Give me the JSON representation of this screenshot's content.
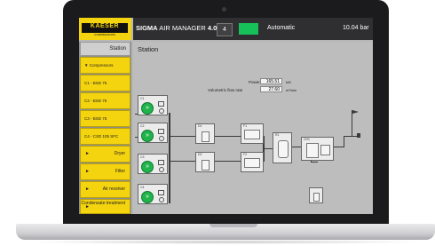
{
  "header": {
    "logo_text": "KAESER",
    "logo_sub": "COMPRESSORS",
    "app_title_bold": "SIGMA",
    "app_title_rest": " AIR MANAGER ",
    "app_version": "4.0",
    "level": "4",
    "mode": "Automatic",
    "pressure": "10.04 bar",
    "status_color": "#16c15a"
  },
  "sidebar": {
    "station": "Station",
    "compressors": "Compressors",
    "items": [
      "C1 - BSD 75",
      "C2 - BSD 75",
      "C3 - BSD 75",
      "C4 - CSD 105 SFC"
    ],
    "dryer": "Dryer",
    "filter": "Filter",
    "air_receiver": "Air receiver",
    "condensate": "Condensate treatment"
  },
  "main": {
    "title": "Station",
    "power_label": "Power",
    "power_value": "165.51",
    "power_unit": "kW",
    "flow_label": "Volumetric flow rate",
    "flow_value": "27.60",
    "flow_unit": "m³/min"
  },
  "diagram": {
    "compressors": [
      "C1",
      "C2",
      "C3",
      "C4"
    ],
    "dryers": [
      "D1",
      "D2"
    ],
    "filters": [
      "F1",
      "F2"
    ],
    "receiver": "R1",
    "condensate": "CH1"
  }
}
